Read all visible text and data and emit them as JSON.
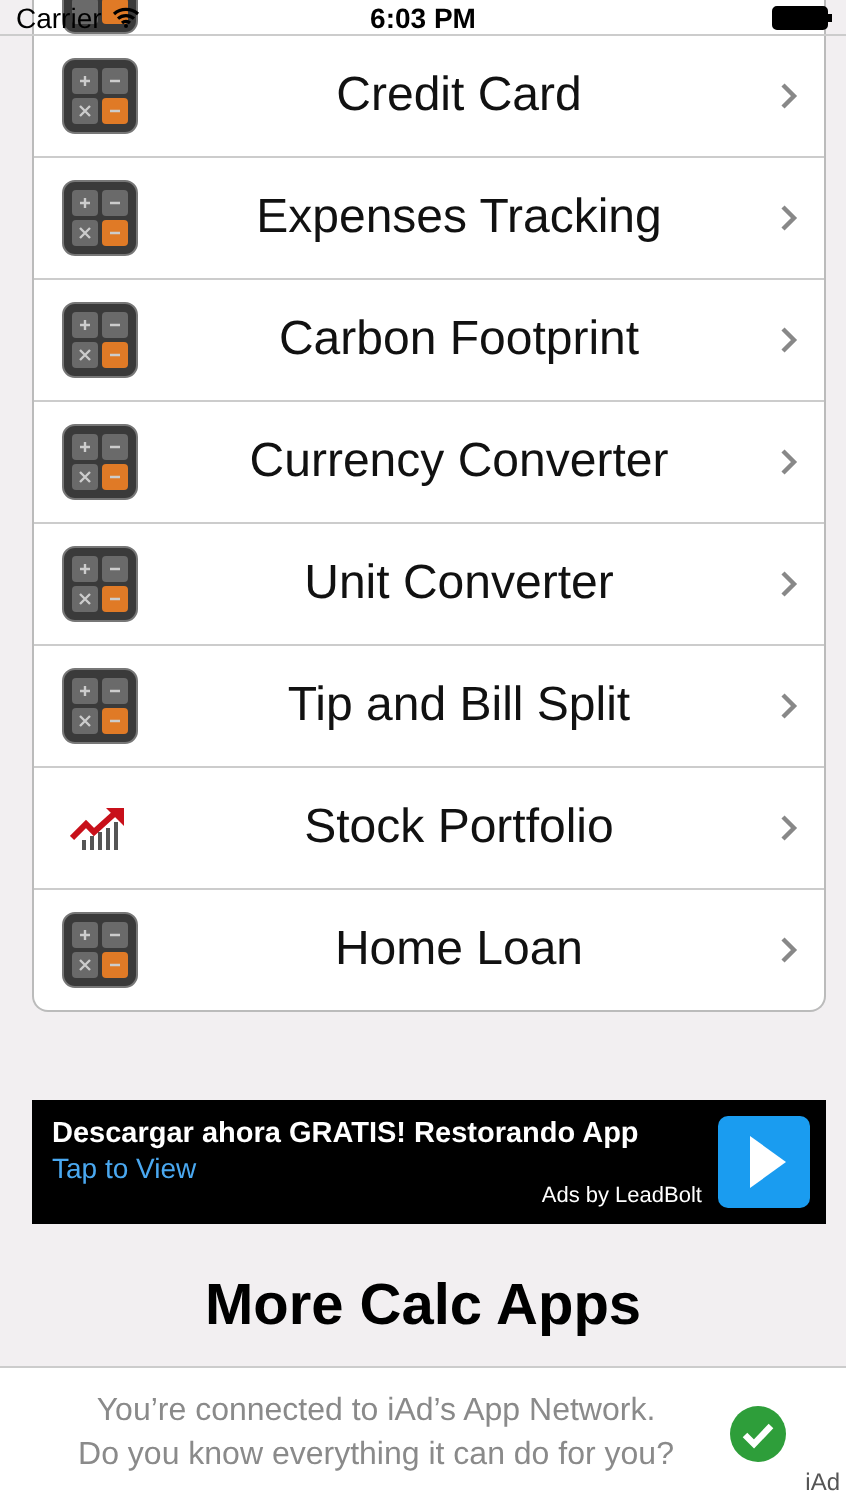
{
  "status_bar": {
    "carrier": "Carrier",
    "time": "6:03 PM"
  },
  "rows": [
    {
      "kind": "calculator",
      "label": "Credit Card"
    },
    {
      "kind": "calculator",
      "label": "Expenses Tracking"
    },
    {
      "kind": "calculator",
      "label": "Carbon Footprint"
    },
    {
      "kind": "calculator",
      "label": "Currency Converter"
    },
    {
      "kind": "calculator",
      "label": "Unit Converter"
    },
    {
      "kind": "calculator",
      "label": "Tip and Bill Split"
    },
    {
      "kind": "chart",
      "label": "Stock Portfolio"
    },
    {
      "kind": "calculator",
      "label": "Home Loan"
    }
  ],
  "ad": {
    "headline": "Descargar ahora GRATIS! Restorando App",
    "link": "Tap to View",
    "credit": "Ads by LeadBolt"
  },
  "heading": "More Calc Apps",
  "iad": {
    "message": "You’re connected to iAd’s App Network.\nDo you know everything it can do for you?",
    "badge": "iAd"
  }
}
